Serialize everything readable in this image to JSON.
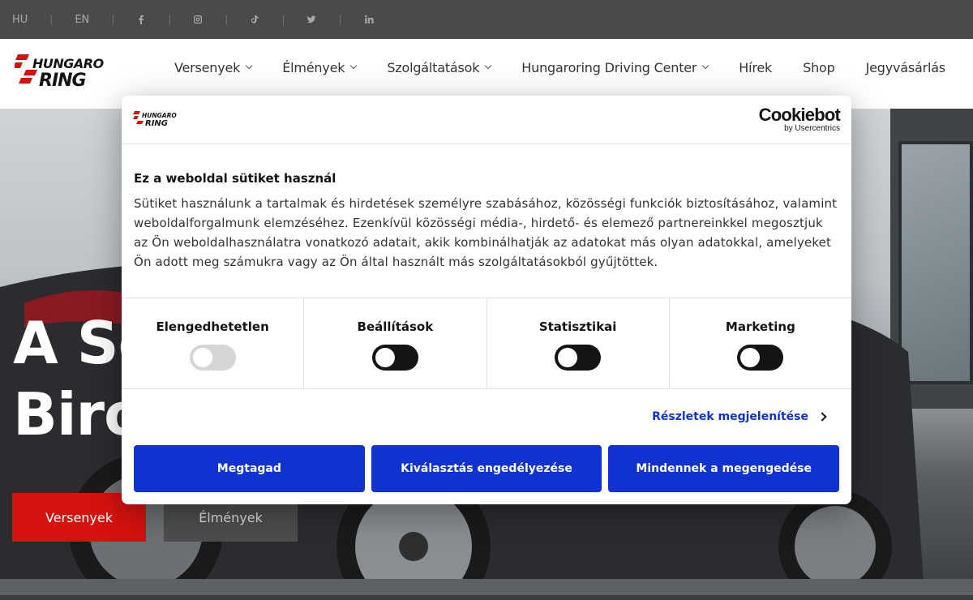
{
  "topbar": {
    "languages": [
      "HU",
      "EN"
    ],
    "social_icons": [
      "facebook-icon",
      "instagram-icon",
      "tiktok-icon",
      "twitter-icon",
      "linkedin-icon"
    ]
  },
  "nav": {
    "logo_text": "HUNGARORING",
    "items": [
      {
        "label": "Versenyek",
        "dropdown": true
      },
      {
        "label": "Élmények",
        "dropdown": true
      },
      {
        "label": "Szolgáltatások",
        "dropdown": true
      },
      {
        "label": "Hungaroring Driving Center",
        "dropdown": true
      },
      {
        "label": "Hírek",
        "dropdown": false
      },
      {
        "label": "Shop",
        "dropdown": false
      },
      {
        "label": "Jegyvásárlás",
        "dropdown": false
      }
    ]
  },
  "hero": {
    "title_line1": "A Se",
    "title_line2": "Biro",
    "btn_primary": "Versenyek",
    "btn_secondary": "Élmények"
  },
  "cookie": {
    "brand": "Cookiebot",
    "brand_sub": "by Usercentrics",
    "title": "Ez a weboldal sütiket használ",
    "text": "Sütiket használunk a tartalmak és hirdetések személyre szabásához, közösségi funkciók biztosításához, valamint weboldalforgalmunk elemzéséhez. Ezenkívül közösségi média-, hirdető- és elemező partnereinkkel megosztjuk az Ön weboldalhasználatra vonatkozó adatait, akik kombinálhatják az adatokat más olyan adatokkal, amelyeket Ön adott meg számukra vagy az Ön által használt más szolgáltatásokból gyűjtöttek.",
    "categories": [
      {
        "label": "Elengedhetetlen",
        "checked": true,
        "disabled": true
      },
      {
        "label": "Beállítások",
        "checked": false,
        "disabled": false
      },
      {
        "label": "Statisztikai",
        "checked": false,
        "disabled": false
      },
      {
        "label": "Marketing",
        "checked": false,
        "disabled": false
      }
    ],
    "details_link": "Részletek megjelenítése",
    "buttons": {
      "deny": "Megtagad",
      "allow_selection": "Kiválasztás engedélyezése",
      "allow_all": "Mindennek a megengedése"
    },
    "accent_color": "#1032cf"
  }
}
